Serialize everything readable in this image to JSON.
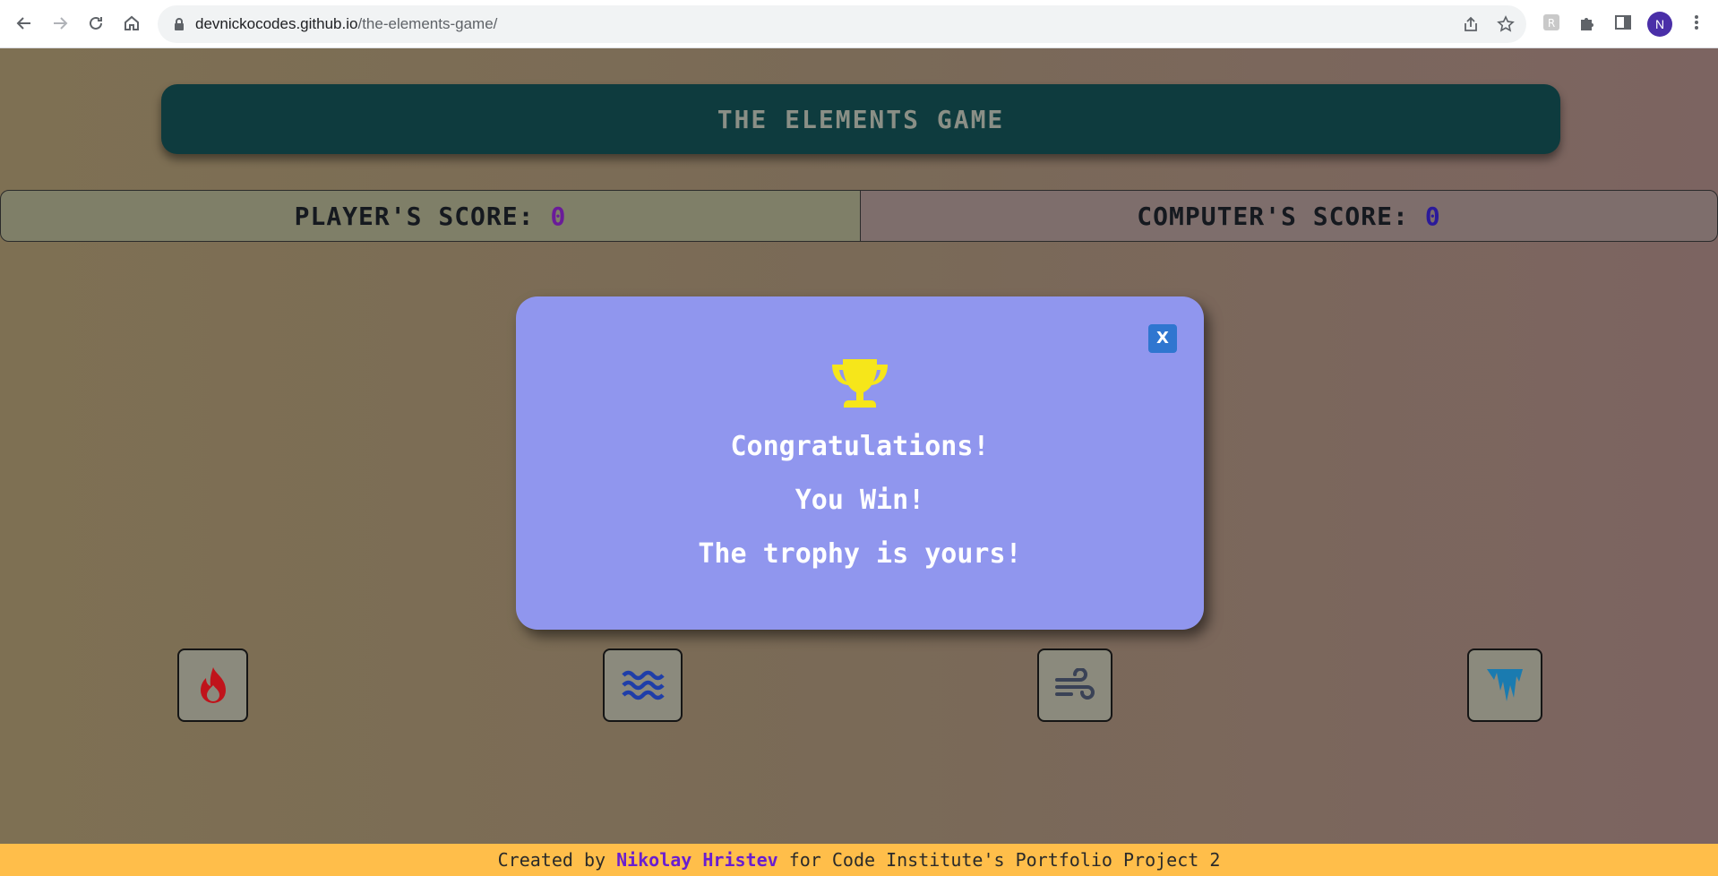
{
  "browser": {
    "url_domain": "devnickocodes.github.io",
    "url_path": "/the-elements-game/",
    "profile_initial": "N",
    "icons": [
      "back-icon",
      "forward-icon",
      "reload-icon",
      "home-icon",
      "lock-icon",
      "share-icon",
      "star-icon",
      "extension-icon",
      "puzzle-icon",
      "side-panel-icon",
      "kebab-menu-icon"
    ]
  },
  "header": {
    "title": "THE ELEMENTS GAME"
  },
  "scores": {
    "player_label": "PLAYER'S SCORE:",
    "player_value": "0",
    "computer_label": "COMPUTER'S SCORE:",
    "computer_value": "0"
  },
  "choices": [
    {
      "name": "fire",
      "icon": "fire-icon",
      "color": "#c0131b"
    },
    {
      "name": "water",
      "icon": "water-icon",
      "color": "#1f3ea8"
    },
    {
      "name": "air",
      "icon": "wind-icon",
      "color": "#3a4256"
    },
    {
      "name": "ice",
      "icon": "icicles-icon",
      "color": "#1a7bb0"
    }
  ],
  "modal": {
    "close_label": "X",
    "icon": "trophy-icon",
    "icon_color": "#f6e61a",
    "line1": "Congratulations!",
    "line2": "You Win!",
    "line3": "The trophy is yours!"
  },
  "footer": {
    "prefix": "Created by ",
    "author": "Nikolay Hristev",
    "suffix": " for Code Institute's Portfolio Project 2"
  }
}
